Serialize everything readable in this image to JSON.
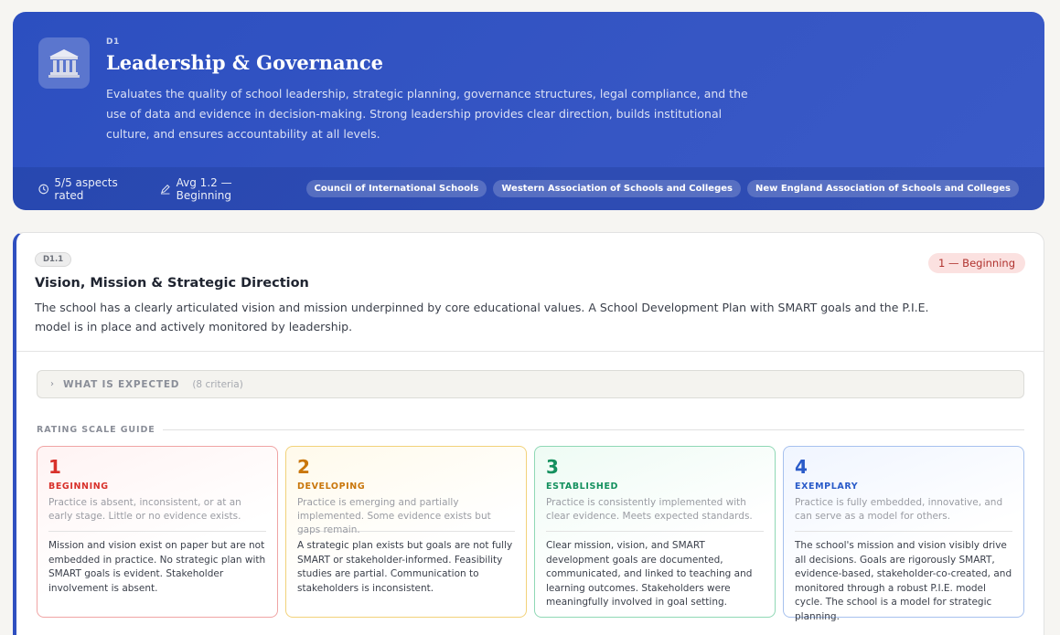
{
  "domain": {
    "code": "D1",
    "title": "Leadership & Governance",
    "description": "Evaluates the quality of school leadership, strategic planning, governance structures, legal compliance, and the use of data and evidence in decision-making. Strong leadership provides clear direction, builds institutional culture, and ensures accountability at all levels.",
    "icon": "building-columns-icon",
    "aspects_rated": "5/5 aspects rated",
    "average": "Avg 1.2 — Beginning",
    "accreditors": [
      "Council of International Schools",
      "Western Association of Schools and Colleges",
      "New England Association of Schools and Colleges"
    ]
  },
  "aspect": {
    "code": "D1.1",
    "title": "Vision, Mission & Strategic Direction",
    "description": "The school has a clearly articulated vision and mission underpinned by core educational values. A School Development Plan with SMART goals and the P.I.E. model is in place and actively monitored by leadership.",
    "rating": "1 — Beginning",
    "expected_label": "WHAT IS EXPECTED",
    "expected_count": "(8 criteria)",
    "scale_label": "RATING SCALE GUIDE",
    "levels": [
      {
        "number": "1",
        "name": "BEGINNING",
        "color": "#d8312b",
        "description": "Practice is absent, inconsistent, or at an early stage. Little or no evidence exists.",
        "detail": "Mission and vision exist on paper but are not embedded in practice. No strategic plan with SMART goals is evident. Stakeholder involvement is absent."
      },
      {
        "number": "2",
        "name": "DEVELOPING",
        "color": "#c9760b",
        "description": "Practice is emerging and partially implemented. Some evidence exists but gaps remain.",
        "detail": "A strategic plan exists but goals are not fully SMART or stakeholder-informed. Feasibility studies are partial. Communication to stakeholders is inconsistent."
      },
      {
        "number": "3",
        "name": "ESTABLISHED",
        "color": "#14905e",
        "description": "Practice is consistently implemented with clear evidence. Meets expected standards.",
        "detail": "Clear mission, vision, and SMART development goals are documented, communicated, and linked to teaching and learning outcomes. Stakeholders were meaningfully involved in goal setting."
      },
      {
        "number": "4",
        "name": "EXEMPLARY",
        "color": "#2a5bc9",
        "description": "Practice is fully embedded, innovative, and can serve as a model for others.",
        "detail": "The school's mission and vision visibly drive all decisions. Goals are rigorously SMART, evidence-based, stakeholder-co-created, and monitored through a robust P.I.E. model cycle. The school is a model for strategic planning."
      }
    ]
  },
  "colors": {
    "brand": "#3353c3",
    "rating_bg": "#fbe1e0",
    "rating_text": "#b0322e"
  }
}
